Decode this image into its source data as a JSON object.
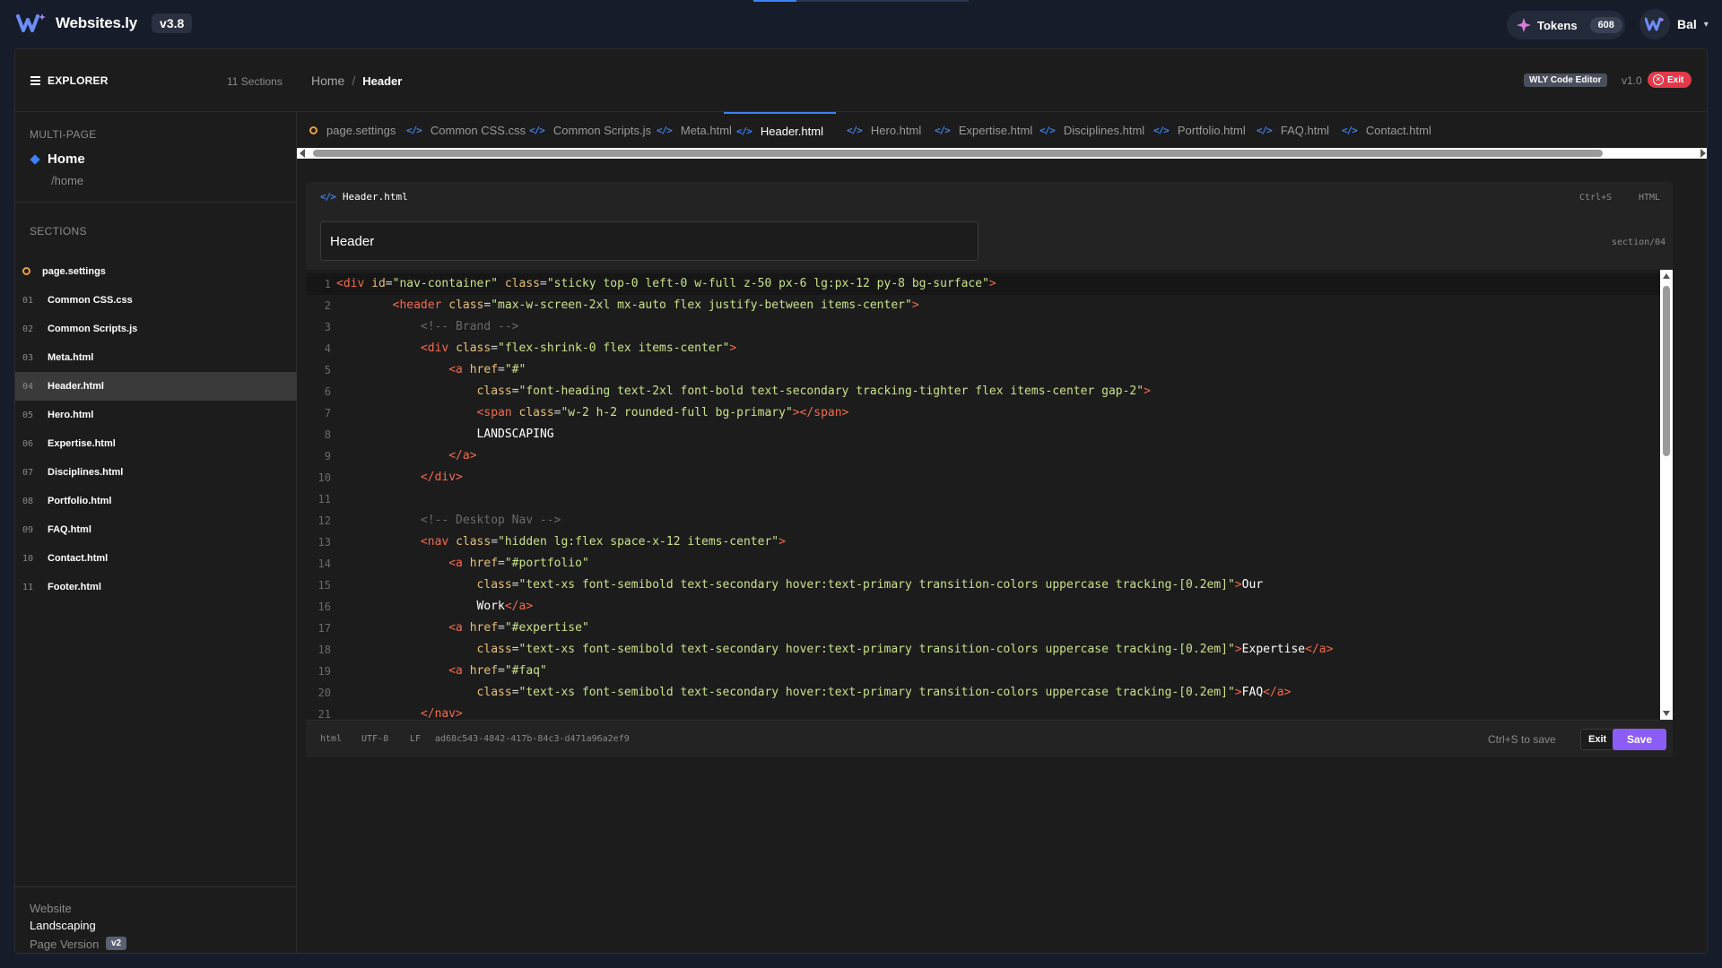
{
  "app": {
    "name": "Websites.ly",
    "version": "v3.8",
    "tokens_label": "Tokens",
    "tokens_count": "608",
    "user_name": "Bal"
  },
  "header": {
    "explorer_label": "EXPLORER",
    "sections_count": "11 Sections",
    "breadcrumb": {
      "home": "Home",
      "separator": "/",
      "current": "Header"
    },
    "editor_badge": "WLY Code Editor",
    "editor_version": "v1.0",
    "exit_label": "Exit"
  },
  "sidebar": {
    "multipage_label": "MULTI-PAGE",
    "page_name": "Home",
    "page_path": "/home",
    "sections_label": "SECTIONS",
    "settings_item": "page.settings",
    "sections": [
      {
        "num": "01",
        "name": "Common CSS.css"
      },
      {
        "num": "02",
        "name": "Common Scripts.js"
      },
      {
        "num": "03",
        "name": "Meta.html"
      },
      {
        "num": "04",
        "name": "Header.html",
        "active": true
      },
      {
        "num": "05",
        "name": "Hero.html"
      },
      {
        "num": "06",
        "name": "Expertise.html"
      },
      {
        "num": "07",
        "name": "Disciplines.html"
      },
      {
        "num": "08",
        "name": "Portfolio.html"
      },
      {
        "num": "09",
        "name": "FAQ.html"
      },
      {
        "num": "10",
        "name": "Contact.html"
      },
      {
        "num": "11",
        "name": "Footer.html"
      }
    ],
    "website_label": "Website",
    "website_name": "Landscaping",
    "page_version_label": "Page Version",
    "page_version": "v2"
  },
  "tabs": [
    {
      "label": "page.settings",
      "icon": "gear-icon"
    },
    {
      "label": "Common CSS.css",
      "icon": "code-icon"
    },
    {
      "label": "Common Scripts.js",
      "icon": "code-icon"
    },
    {
      "label": "Meta.html",
      "icon": "code-icon"
    },
    {
      "label": "Header.html",
      "icon": "code-icon",
      "active": true
    },
    {
      "label": "Hero.html",
      "icon": "code-icon"
    },
    {
      "label": "Expertise.html",
      "icon": "code-icon"
    },
    {
      "label": "Disciplines.html",
      "icon": "code-icon"
    },
    {
      "label": "Portfolio.html",
      "icon": "code-icon"
    },
    {
      "label": "FAQ.html",
      "icon": "code-icon"
    },
    {
      "label": "Contact.html",
      "icon": "code-icon"
    }
  ],
  "editor": {
    "file_name": "Header.html",
    "shortcut": "Ctrl+S",
    "language": "HTML",
    "title_value": "Header",
    "section_path": "section/04",
    "code_icon": "</>",
    "lines": [
      [
        [
          "tag",
          "<div "
        ],
        [
          "attr",
          "id"
        ],
        [
          "eq",
          "="
        ],
        [
          "str",
          "\"nav-container\""
        ],
        [
          "eq",
          " "
        ],
        [
          "attr",
          "class"
        ],
        [
          "eq",
          "="
        ],
        [
          "str",
          "\"sticky top-0 left-0 w-full z-50 px-6 lg:px-12 py-8 bg-surface\""
        ],
        [
          "tag",
          ">"
        ]
      ],
      [
        [
          "text",
          "        "
        ],
        [
          "tag",
          "<header "
        ],
        [
          "attr",
          "class"
        ],
        [
          "eq",
          "="
        ],
        [
          "str",
          "\"max-w-screen-2xl mx-auto flex justify-between items-center\""
        ],
        [
          "tag",
          ">"
        ]
      ],
      [
        [
          "text",
          "            "
        ],
        [
          "cmt",
          "<!-- Brand -->"
        ]
      ],
      [
        [
          "text",
          "            "
        ],
        [
          "tag",
          "<div "
        ],
        [
          "attr",
          "class"
        ],
        [
          "eq",
          "="
        ],
        [
          "str",
          "\"flex-shrink-0 flex items-center\""
        ],
        [
          "tag",
          ">"
        ]
      ],
      [
        [
          "text",
          "                "
        ],
        [
          "tag",
          "<a "
        ],
        [
          "attr",
          "href"
        ],
        [
          "eq",
          "="
        ],
        [
          "str",
          "\"#\""
        ]
      ],
      [
        [
          "text",
          "                    "
        ],
        [
          "attr",
          "class"
        ],
        [
          "eq",
          "="
        ],
        [
          "str",
          "\"font-heading text-2xl font-bold text-secondary tracking-tighter flex items-center gap-2\""
        ],
        [
          "tag",
          ">"
        ]
      ],
      [
        [
          "text",
          "                    "
        ],
        [
          "tag",
          "<span "
        ],
        [
          "attr",
          "class"
        ],
        [
          "eq",
          "="
        ],
        [
          "str",
          "\"w-2 h-2 rounded-full bg-primary\""
        ],
        [
          "tag",
          "></span>"
        ]
      ],
      [
        [
          "text",
          "                    LANDSCAPING"
        ]
      ],
      [
        [
          "text",
          "                "
        ],
        [
          "tag",
          "</a>"
        ]
      ],
      [
        [
          "text",
          "            "
        ],
        [
          "tag",
          "</div>"
        ]
      ],
      [],
      [
        [
          "text",
          "            "
        ],
        [
          "cmt",
          "<!-- Desktop Nav -->"
        ]
      ],
      [
        [
          "text",
          "            "
        ],
        [
          "tag",
          "<nav "
        ],
        [
          "attr",
          "class"
        ],
        [
          "eq",
          "="
        ],
        [
          "str",
          "\"hidden lg:flex space-x-12 items-center\""
        ],
        [
          "tag",
          ">"
        ]
      ],
      [
        [
          "text",
          "                "
        ],
        [
          "tag",
          "<a "
        ],
        [
          "attr",
          "href"
        ],
        [
          "eq",
          "="
        ],
        [
          "str",
          "\"#portfolio\""
        ]
      ],
      [
        [
          "text",
          "                    "
        ],
        [
          "attr",
          "class"
        ],
        [
          "eq",
          "="
        ],
        [
          "str",
          "\"text-xs font-semibold text-secondary hover:text-primary transition-colors uppercase tracking-[0.2em]\""
        ],
        [
          "tag",
          ">"
        ],
        [
          "text",
          "Our"
        ]
      ],
      [
        [
          "text",
          "                    Work"
        ],
        [
          "tag",
          "</a>"
        ]
      ],
      [
        [
          "text",
          "                "
        ],
        [
          "tag",
          "<a "
        ],
        [
          "attr",
          "href"
        ],
        [
          "eq",
          "="
        ],
        [
          "str",
          "\"#expertise\""
        ]
      ],
      [
        [
          "text",
          "                    "
        ],
        [
          "attr",
          "class"
        ],
        [
          "eq",
          "="
        ],
        [
          "str",
          "\"text-xs font-semibold text-secondary hover:text-primary transition-colors uppercase tracking-[0.2em]\""
        ],
        [
          "tag",
          ">"
        ],
        [
          "text",
          "Expertise"
        ],
        [
          "tag",
          "</a>"
        ]
      ],
      [
        [
          "text",
          "                "
        ],
        [
          "tag",
          "<a "
        ],
        [
          "attr",
          "href"
        ],
        [
          "eq",
          "="
        ],
        [
          "str",
          "\"#faq\""
        ]
      ],
      [
        [
          "text",
          "                    "
        ],
        [
          "attr",
          "class"
        ],
        [
          "eq",
          "="
        ],
        [
          "str",
          "\"text-xs font-semibold text-secondary hover:text-primary transition-colors uppercase tracking-[0.2em]\""
        ],
        [
          "tag",
          ">"
        ],
        [
          "text",
          "FAQ"
        ],
        [
          "tag",
          "</a>"
        ]
      ],
      [
        [
          "text",
          "            "
        ],
        [
          "tag",
          "</nav>"
        ]
      ]
    ]
  },
  "status_bar": {
    "lang": "html",
    "encoding": "UTF-8",
    "line_ending": "LF",
    "doc_id": "ad68c543-4842-417b-84c3-d471a96a2ef9",
    "save_hint": "Ctrl+S to save",
    "exit_label": "Exit",
    "save_label": "Save"
  },
  "colors": {
    "accent": "#3b82f6",
    "save": "#8b5cf6",
    "exit": "#e23a4a",
    "settings": "#e8a23a"
  }
}
